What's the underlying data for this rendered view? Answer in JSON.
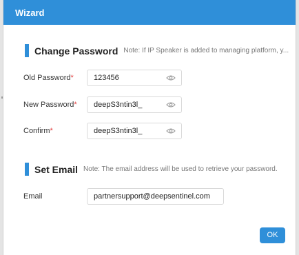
{
  "dialog": {
    "title": "Wizard"
  },
  "change_password": {
    "title": "Change Password",
    "note": "Note: If IP Speaker is added to managing platform, y...",
    "fields": [
      {
        "label": "Old Password",
        "required_mark": "*",
        "value": "123456",
        "icon": "eye-icon"
      },
      {
        "label": "New Password",
        "required_mark": "*",
        "value": "deepS3ntin3l_",
        "icon": "eye-icon"
      },
      {
        "label": "Confirm",
        "required_mark": "*",
        "value": "deepS3ntin3l_",
        "icon": "eye-icon"
      }
    ]
  },
  "set_email": {
    "title": "Set Email",
    "note": "Note: The email address will be used to retrieve your password.",
    "field": {
      "label": "Email",
      "value": "partnersupport@deepsentinel.com"
    }
  },
  "actions": {
    "ok_label": "OK"
  },
  "colors": {
    "accent": "#2f8fd9",
    "required": "#e23b3b"
  }
}
